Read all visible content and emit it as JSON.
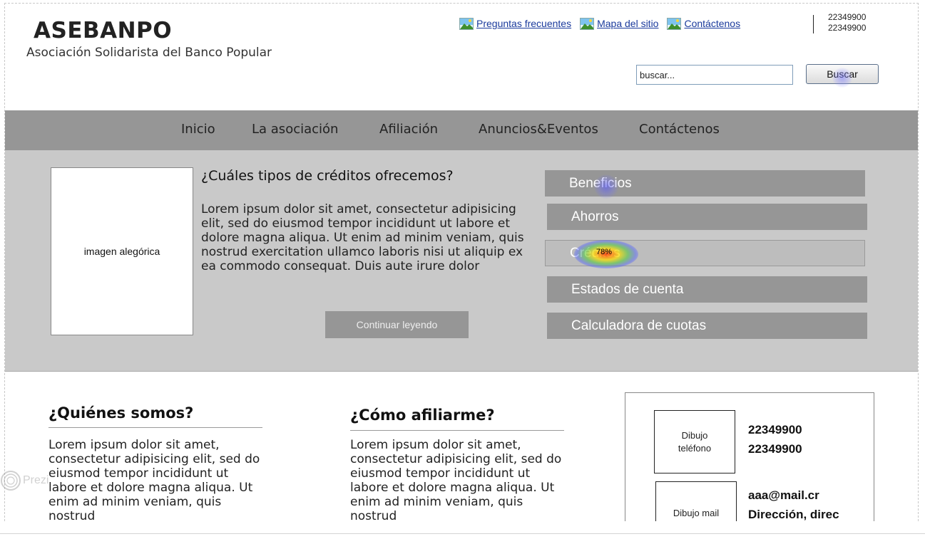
{
  "header": {
    "logo": "ASEBANPO",
    "subtitle": "Asociación Solidarista del Banco Popular",
    "links": [
      {
        "label": "Preguntas frecuentes",
        "icon": "image-icon"
      },
      {
        "label": "Mapa del sitio",
        "icon": "image-icon"
      },
      {
        "label": "Contáctenos",
        "icon": "image-icon"
      }
    ],
    "phones": [
      "22349900",
      "22349900"
    ],
    "search": {
      "value": "buscar...",
      "button": "Buscar"
    }
  },
  "nav": [
    "Inicio",
    "La asociación",
    "Afiliación",
    "Anuncios&Eventos",
    "Contáctenos"
  ],
  "hero": {
    "image_label": "imagen alegórica",
    "title": "¿Cuáles tipos de créditos ofrecemos?",
    "text": "Lorem ipsum dolor sit amet, consectetur adipisicing elit, sed do eiusmod tempor incididunt ut labore et dolore magna aliqua. Ut enim ad minim veniam, quis nostrud exercitation ullamco laboris nisi ut aliquip ex ea commodo consequat. Duis aute irure dolor",
    "button": "Continuar leyendo",
    "menu": [
      "Beneficios",
      "Ahorros",
      "Créditos",
      "Estados de cuenta",
      "Calculadora de cuotas"
    ],
    "heatmap_label": "78%"
  },
  "sections": {
    "about": {
      "title": "¿Quiénes somos?",
      "text": "Lorem ipsum dolor sit amet, consectetur adipisicing elit, sed do eiusmod tempor incididunt ut labore et dolore magna aliqua. Ut enim ad minim veniam, quis nostrud"
    },
    "join": {
      "title": "¿Cómo afiliarme?",
      "text": "Lorem ipsum dolor sit amet, consectetur adipisicing elit, sed do eiusmod tempor incididunt ut labore et dolore magna aliqua. Ut enim ad minim veniam, quis nostrud"
    }
  },
  "contact": {
    "phone_drawing": "Dibujo teléfono",
    "phones": [
      "22349900",
      "22349900"
    ],
    "mail_drawing": "Dibujo mail",
    "email": "aaa@mail.cr",
    "address": "Dirección, direc"
  },
  "watermark": "Prezi",
  "colors": {
    "nav": "#969696",
    "hero_bg": "#c9c9c9",
    "link": "#1a3a9c"
  }
}
